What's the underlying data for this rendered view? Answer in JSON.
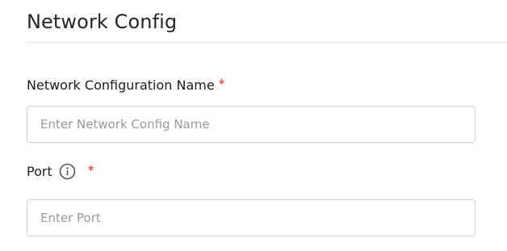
{
  "header": {
    "title": "Network Config"
  },
  "form": {
    "network_name": {
      "label": "Network Configuration Name",
      "required_mark": "*",
      "placeholder": "Enter Network Config Name",
      "value": ""
    },
    "port": {
      "label": "Port",
      "required_mark": "*",
      "info_icon": "info-circle-icon",
      "placeholder": "Enter Port",
      "value": ""
    }
  },
  "colors": {
    "required": "#e02020",
    "border": "#cfcfcf",
    "placeholder": "#9a9a9a"
  }
}
